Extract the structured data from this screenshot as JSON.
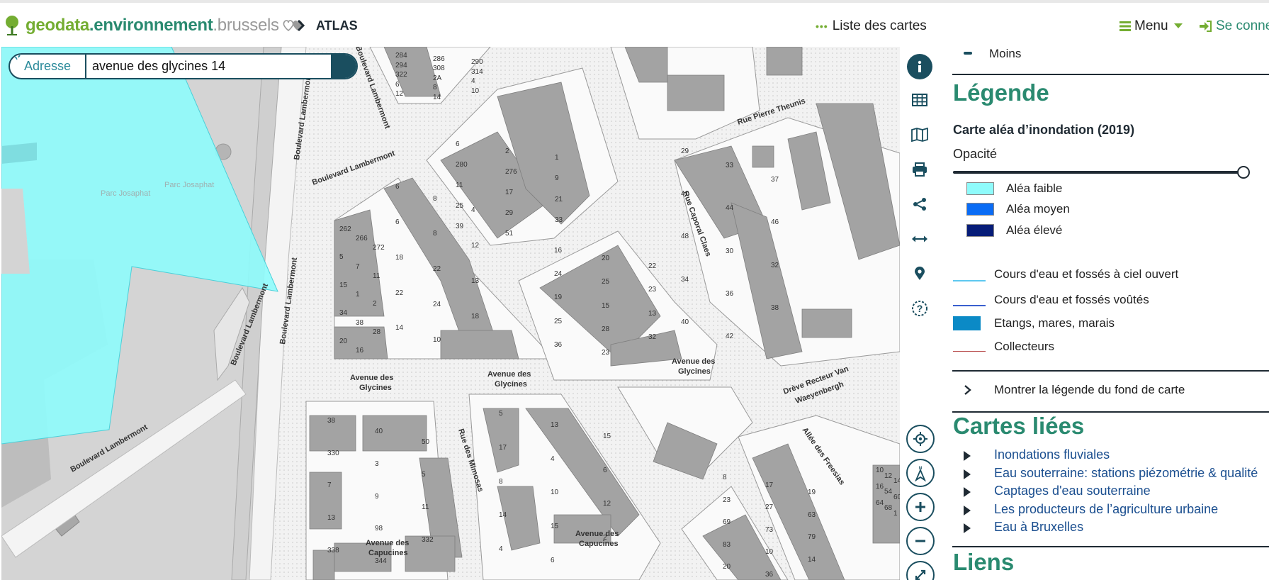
{
  "header": {
    "brand_part1": "geodata",
    "brand_part2": ".environnement",
    "brand_part3": ".brussels",
    "breadcrumb_current": "ATLAS",
    "nav_list_label": "Liste des cartes",
    "nav_menu_label": "Menu",
    "nav_login_label": "Se connecter"
  },
  "search": {
    "type_label": "Adresse",
    "value": "avenue des glycines 14"
  },
  "map": {
    "labels": [
      "Parc Josaphat",
      "Parc Josaphat",
      "Boulevard Lambermont",
      "Boulevard Lambermont",
      "Boulevard Lambermont",
      "Boulevard Lambermont",
      "Boulevard Lambermont",
      "Boulevard Lambermont",
      "Rue Pierre Theunis",
      "Rue Caporal Claes",
      "Avenue des",
      "Glycines",
      "Avenue des",
      "Glycines",
      "Avenue des",
      "Glycines",
      "Drève Recteur Van",
      "Waeyenbergh",
      "Allée des Freesias",
      "Rue des Mimosas",
      "Avenue des",
      "Capucines",
      "Avenue des",
      "Capucines"
    ],
    "house_numbers": [
      "262",
      "266",
      "272",
      "5",
      "7",
      "11",
      "15",
      "1",
      "2",
      "34",
      "38",
      "28",
      "20",
      "16",
      "6",
      "8",
      "4",
      "6",
      "8",
      "12",
      "18",
      "22",
      "13",
      "22",
      "24",
      "18",
      "14",
      "10",
      "6",
      "2",
      "1",
      "280",
      "276",
      "9",
      "11",
      "17",
      "21",
      "25",
      "29",
      "33",
      "39",
      "51",
      "284",
      "286",
      "290",
      "294",
      "308",
      "314",
      "322",
      "2A",
      "4",
      "6",
      "8",
      "10",
      "12",
      "14",
      "16",
      "20",
      "22",
      "24",
      "25",
      "23",
      "19",
      "15",
      "13",
      "25",
      "28",
      "32",
      "36",
      "23",
      "29",
      "33",
      "37",
      "41",
      "44",
      "46",
      "48",
      "30",
      "32",
      "34",
      "36",
      "38",
      "40",
      "42",
      "38",
      "40",
      "50",
      "330",
      "3",
      "5",
      "7",
      "9",
      "11",
      "13",
      "98",
      "332",
      "338",
      "344",
      "5",
      "13",
      "15",
      "17",
      "4",
      "6",
      "8",
      "10",
      "12",
      "14",
      "15",
      "2",
      "4",
      "6",
      "8",
      "17",
      "19",
      "23",
      "27",
      "63",
      "69",
      "73",
      "79",
      "83",
      "10",
      "14",
      "20",
      "36",
      "10",
      "12",
      "14",
      "16",
      "54",
      "60",
      "64",
      "68",
      "1"
    ]
  },
  "tools": [
    "info-icon",
    "table-icon",
    "map-icon",
    "print-icon",
    "share-icon",
    "measure-icon",
    "location-pin-icon",
    "help-icon"
  ],
  "controls": [
    "locate-icon",
    "compass-icon",
    "zoom-in-icon",
    "zoom-out-icon",
    "fullscreen-icon"
  ],
  "panel": {
    "moins_label": "Moins",
    "legend_title": "Légende",
    "layer_title": "Carte aléa d’inondation (2019)",
    "opacity_label": "Opacité",
    "opacity_value": 0.92,
    "legend_items": [
      {
        "label": "Aléa faible",
        "color": "#8ffbfb"
      },
      {
        "label": "Aléa moyen",
        "color": "#0a6cf5"
      },
      {
        "label": "Aléa élevé",
        "color": "#061c78"
      }
    ],
    "water_items": [
      {
        "label": "Cours d'eau et fossés à ciel ouvert",
        "color": "#5ec8f0"
      },
      {
        "label": "Cours d'eau et fossés voûtés",
        "color": "#3a5fcf"
      },
      {
        "label": "Etangs, mares, marais",
        "color": "#0b8ac6"
      },
      {
        "label": "Collecteurs",
        "color": "#b84a4a"
      }
    ],
    "basemap_legend_label": "Montrer la légende du fond de carte",
    "related_title": "Cartes liées",
    "related_links": [
      "Inondations fluviales",
      "Eau souterraine: stations piézométrie & qualité",
      "Captages d'eau souterraine",
      "Les producteurs de l’agriculture urbaine",
      "Eau à Bruxelles"
    ],
    "links_title": "Liens"
  },
  "colors": {
    "brand_green": "#74ad32",
    "brand_teal": "#2a8a70",
    "dark_teal": "#1a4e5f"
  }
}
